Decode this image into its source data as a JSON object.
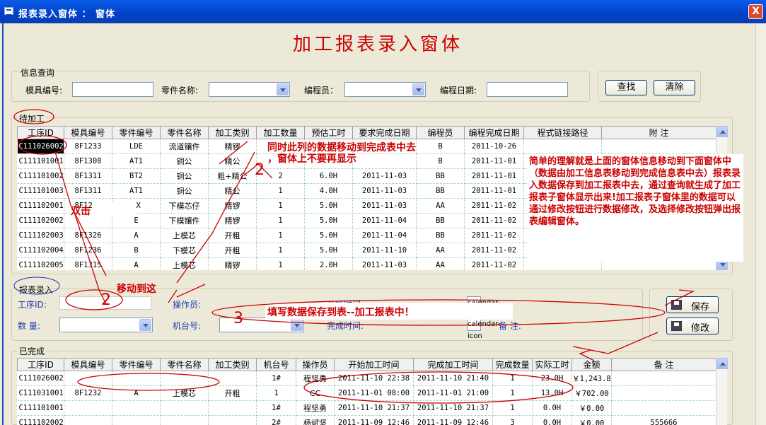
{
  "window": {
    "title": "报表录入窗体 ： 窗体",
    "close_label": "X",
    "heading": "加工报表录入窗体"
  },
  "query": {
    "group_label": "信息查询",
    "mold_label": "模具编号:",
    "part_label": "零件名称:",
    "programmer_label": "编程员：",
    "date_label": "编程日期:",
    "search_button": "查找",
    "clear_button": "清除"
  },
  "pending": {
    "group_label": "待加工",
    "columns": [
      "工序ID",
      "模具编号",
      "零件编号",
      "零件名称",
      "加工类别",
      "加工数量",
      "预估工时",
      "要求完成日期",
      "编程员",
      "编程完成日期",
      "程式链接路径",
      "附 注"
    ],
    "rows": [
      [
        "C111026002",
        "8F1233",
        "LDE",
        "流道镶件",
        "精锣",
        "",
        "",
        "",
        "B",
        "2011-10-26",
        "",
        ""
      ],
      [
        "C111101001",
        "8F1308",
        "AT1",
        "铜公",
        "精公",
        "",
        "",
        "",
        "B",
        "2011-11-01",
        "",
        ""
      ],
      [
        "C111101002",
        "8F1311",
        "BT2",
        "铜公",
        "粗+精公",
        "2",
        "6.0H",
        "2011-11-03",
        "BB",
        "2011-11-01",
        "",
        ""
      ],
      [
        "C111101003",
        "8F1311",
        "AT1",
        "铜公",
        "精公",
        "1",
        "4.0H",
        "2011-11-03",
        "BB",
        "2011-11-01",
        "",
        ""
      ],
      [
        "C111102001",
        "8F1257",
        "PX",
        "下模芯仔",
        "精锣",
        "1",
        "5.0H",
        "2011-11-03",
        "AA",
        "2011-11-02",
        "",
        ""
      ],
      [
        "C111102002",
        "",
        "E",
        "下模镶件",
        "精锣",
        "1",
        "5.0H",
        "2011-11-04",
        "BB",
        "2011-11-02",
        "",
        ""
      ],
      [
        "C111102003",
        "8F1326",
        "A",
        "上模芯",
        "开粗",
        "1",
        "5.0H",
        "2011-11-04",
        "BB",
        "2011-11-02",
        "",
        ""
      ],
      [
        "C111102004",
        "8F1236",
        "B",
        "下模芯",
        "开粗",
        "1",
        "5.0H",
        "2011-11-10",
        "AA",
        "2011-11-02",
        "",
        ""
      ],
      [
        "C111102005",
        "8F1315",
        "A",
        "上模芯",
        "精锣",
        "1",
        "2.0H",
        "2011-11-03",
        "AA",
        "2011-11-02",
        "",
        ""
      ]
    ]
  },
  "entry": {
    "group_label": "报表录入",
    "process_id_label": "工序ID:",
    "operator_label": "操作员:",
    "start_time_label": "开始时间:",
    "quantity_label": "数 量:",
    "machine_label": "机台号:",
    "finish_time_label": "完成时间:",
    "remark_label": "备 注:",
    "save_button": "保存",
    "modify_button": "修改",
    "cal_icon": "calendar-icon"
  },
  "completed": {
    "group_label": "已完成",
    "columns": [
      "工序ID",
      "模具编号",
      "零件编号",
      "零件名称",
      "加工类别",
      "机台号",
      "操作员",
      "开始加工时间",
      "完成加工时间",
      "完成数量",
      "实际工时",
      "金额",
      "备 注"
    ],
    "rows": [
      [
        "C111026002",
        "",
        "",
        "",
        "",
        "1#",
        "程坚勇",
        "2011-11-10 22:38",
        "2011-11-10 21:40",
        "1",
        "23.0H",
        "￥1,243.8(",
        ""
      ],
      [
        "C111031001",
        "8F1232",
        "A",
        "上模芯",
        "开粗",
        "1",
        "CC",
        "2011-11-01 08:00",
        "2011-11-01 21:00",
        "1",
        "13.0H",
        "￥702.00",
        ""
      ],
      [
        "C111101001",
        "",
        "",
        "",
        "",
        "1#",
        "程坚勇",
        "2011-11-10 21:37",
        "2011-11-10 21:37",
        "1",
        "0.0H",
        "￥0.00",
        ""
      ],
      [
        "C111102002",
        "",
        "",
        "",
        "",
        "2#",
        "杨斌坚",
        "2011-11-09 12:46",
        "2011-11-09 12:46",
        "3",
        "0.0H",
        "￥0.00",
        "555666"
      ]
    ]
  },
  "annotations": {
    "note_top": "同时此列的数据移动到完成表中去",
    "note_top2": "，窗体上不要再显示",
    "double_click": "双击",
    "move_here": "移动到这",
    "save_note": "填写数据保存到表--加工报表中！",
    "explain": "简单的理解就是上面的窗体信息移动到下面窗体中（数据由加工信息表移动到完成信息表中去）报表录入数据保存到加工报表中去，通过查询就生成了加工报表子窗体显示出来!加工报表子窗体里的数据可以通过修改按钮进行数据修改，及选择修改按钮弹出报表编辑窗体。",
    "mark_2a": "2",
    "mark_2b": "2",
    "mark_3": "3"
  },
  "colors": {
    "accent_red": "#cc0000",
    "titlebar_blue": "#0040c8",
    "label_blue": "#1a3fb0"
  }
}
